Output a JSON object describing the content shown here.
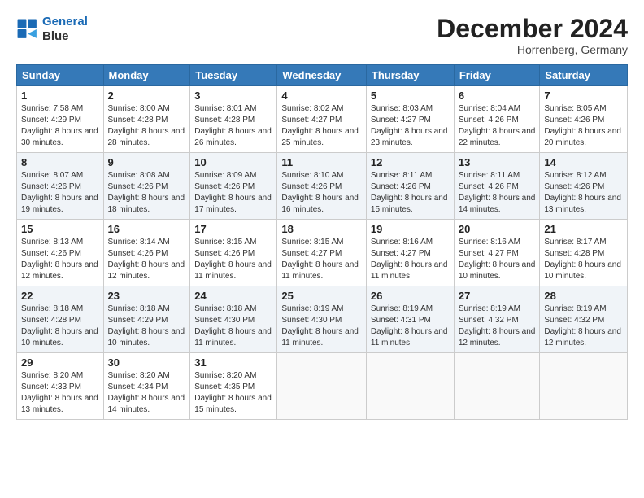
{
  "header": {
    "logo_line1": "General",
    "logo_line2": "Blue",
    "month_title": "December 2024",
    "location": "Horrenberg, Germany"
  },
  "weekdays": [
    "Sunday",
    "Monday",
    "Tuesday",
    "Wednesday",
    "Thursday",
    "Friday",
    "Saturday"
  ],
  "weeks": [
    [
      {
        "day": "1",
        "sunrise": "7:58 AM",
        "sunset": "4:29 PM",
        "daylight": "8 hours and 30 minutes."
      },
      {
        "day": "2",
        "sunrise": "8:00 AM",
        "sunset": "4:28 PM",
        "daylight": "8 hours and 28 minutes."
      },
      {
        "day": "3",
        "sunrise": "8:01 AM",
        "sunset": "4:28 PM",
        "daylight": "8 hours and 26 minutes."
      },
      {
        "day": "4",
        "sunrise": "8:02 AM",
        "sunset": "4:27 PM",
        "daylight": "8 hours and 25 minutes."
      },
      {
        "day": "5",
        "sunrise": "8:03 AM",
        "sunset": "4:27 PM",
        "daylight": "8 hours and 23 minutes."
      },
      {
        "day": "6",
        "sunrise": "8:04 AM",
        "sunset": "4:26 PM",
        "daylight": "8 hours and 22 minutes."
      },
      {
        "day": "7",
        "sunrise": "8:05 AM",
        "sunset": "4:26 PM",
        "daylight": "8 hours and 20 minutes."
      }
    ],
    [
      {
        "day": "8",
        "sunrise": "8:07 AM",
        "sunset": "4:26 PM",
        "daylight": "8 hours and 19 minutes."
      },
      {
        "day": "9",
        "sunrise": "8:08 AM",
        "sunset": "4:26 PM",
        "daylight": "8 hours and 18 minutes."
      },
      {
        "day": "10",
        "sunrise": "8:09 AM",
        "sunset": "4:26 PM",
        "daylight": "8 hours and 17 minutes."
      },
      {
        "day": "11",
        "sunrise": "8:10 AM",
        "sunset": "4:26 PM",
        "daylight": "8 hours and 16 minutes."
      },
      {
        "day": "12",
        "sunrise": "8:11 AM",
        "sunset": "4:26 PM",
        "daylight": "8 hours and 15 minutes."
      },
      {
        "day": "13",
        "sunrise": "8:11 AM",
        "sunset": "4:26 PM",
        "daylight": "8 hours and 14 minutes."
      },
      {
        "day": "14",
        "sunrise": "8:12 AM",
        "sunset": "4:26 PM",
        "daylight": "8 hours and 13 minutes."
      }
    ],
    [
      {
        "day": "15",
        "sunrise": "8:13 AM",
        "sunset": "4:26 PM",
        "daylight": "8 hours and 12 minutes."
      },
      {
        "day": "16",
        "sunrise": "8:14 AM",
        "sunset": "4:26 PM",
        "daylight": "8 hours and 12 minutes."
      },
      {
        "day": "17",
        "sunrise": "8:15 AM",
        "sunset": "4:26 PM",
        "daylight": "8 hours and 11 minutes."
      },
      {
        "day": "18",
        "sunrise": "8:15 AM",
        "sunset": "4:27 PM",
        "daylight": "8 hours and 11 minutes."
      },
      {
        "day": "19",
        "sunrise": "8:16 AM",
        "sunset": "4:27 PM",
        "daylight": "8 hours and 11 minutes."
      },
      {
        "day": "20",
        "sunrise": "8:16 AM",
        "sunset": "4:27 PM",
        "daylight": "8 hours and 10 minutes."
      },
      {
        "day": "21",
        "sunrise": "8:17 AM",
        "sunset": "4:28 PM",
        "daylight": "8 hours and 10 minutes."
      }
    ],
    [
      {
        "day": "22",
        "sunrise": "8:18 AM",
        "sunset": "4:28 PM",
        "daylight": "8 hours and 10 minutes."
      },
      {
        "day": "23",
        "sunrise": "8:18 AM",
        "sunset": "4:29 PM",
        "daylight": "8 hours and 10 minutes."
      },
      {
        "day": "24",
        "sunrise": "8:18 AM",
        "sunset": "4:30 PM",
        "daylight": "8 hours and 11 minutes."
      },
      {
        "day": "25",
        "sunrise": "8:19 AM",
        "sunset": "4:30 PM",
        "daylight": "8 hours and 11 minutes."
      },
      {
        "day": "26",
        "sunrise": "8:19 AM",
        "sunset": "4:31 PM",
        "daylight": "8 hours and 11 minutes."
      },
      {
        "day": "27",
        "sunrise": "8:19 AM",
        "sunset": "4:32 PM",
        "daylight": "8 hours and 12 minutes."
      },
      {
        "day": "28",
        "sunrise": "8:19 AM",
        "sunset": "4:32 PM",
        "daylight": "8 hours and 12 minutes."
      }
    ],
    [
      {
        "day": "29",
        "sunrise": "8:20 AM",
        "sunset": "4:33 PM",
        "daylight": "8 hours and 13 minutes."
      },
      {
        "day": "30",
        "sunrise": "8:20 AM",
        "sunset": "4:34 PM",
        "daylight": "8 hours and 14 minutes."
      },
      {
        "day": "31",
        "sunrise": "8:20 AM",
        "sunset": "4:35 PM",
        "daylight": "8 hours and 15 minutes."
      },
      null,
      null,
      null,
      null
    ]
  ]
}
